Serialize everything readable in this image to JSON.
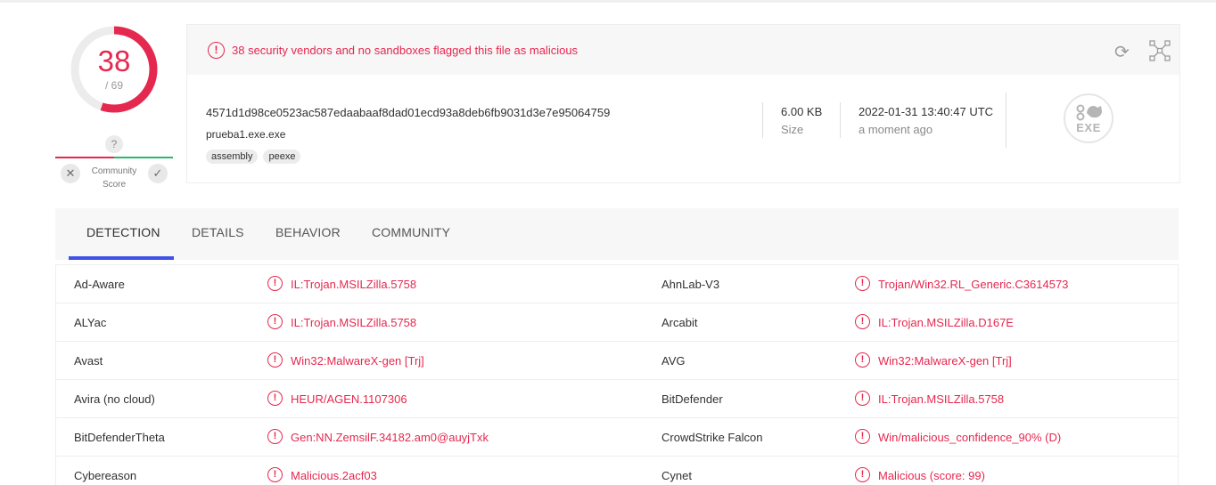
{
  "score": {
    "detections": "38",
    "total": "/ 69",
    "malicious_count": 38,
    "engine_count": 69,
    "ring_color": "#e5284f"
  },
  "community": {
    "unknown_glyph": "?",
    "label_line1": "Community",
    "label_line2": "Score"
  },
  "alert": {
    "text": "38 security vendors and no sandboxes flagged this file as malicious",
    "color": "#e5284f"
  },
  "file": {
    "hash": "4571d1d98ce0523ac587edaabaaf8dad01ecd93a8deb6fb9031d3e7e95064759",
    "name": "prueba1.exe.exe",
    "tags": [
      "assembly",
      "peexe"
    ],
    "size_value": "6.00 KB",
    "size_label": "Size",
    "date_value": "2022-01-31 13:40:47 UTC",
    "date_label": "a moment ago",
    "type_icon": "EXE"
  },
  "tabs": [
    {
      "label": "DETECTION",
      "active": true
    },
    {
      "label": "DETAILS",
      "active": false
    },
    {
      "label": "BEHAVIOR",
      "active": false
    },
    {
      "label": "COMMUNITY",
      "active": false
    }
  ],
  "detections": [
    {
      "left": {
        "engine": "Ad-Aware",
        "result": "IL:Trojan.MSILZilla.5758"
      },
      "right": {
        "engine": "AhnLab-V3",
        "result": "Trojan/Win32.RL_Generic.C3614573"
      }
    },
    {
      "left": {
        "engine": "ALYac",
        "result": "IL:Trojan.MSILZilla.5758"
      },
      "right": {
        "engine": "Arcabit",
        "result": "IL:Trojan.MSILZilla.D167E"
      }
    },
    {
      "left": {
        "engine": "Avast",
        "result": "Win32:MalwareX-gen [Trj]"
      },
      "right": {
        "engine": "AVG",
        "result": "Win32:MalwareX-gen [Trj]"
      }
    },
    {
      "left": {
        "engine": "Avira (no cloud)",
        "result": "HEUR/AGEN.1107306"
      },
      "right": {
        "engine": "BitDefender",
        "result": "IL:Trojan.MSILZilla.5758"
      }
    },
    {
      "left": {
        "engine": "BitDefenderTheta",
        "result": "Gen:NN.ZemsilF.34182.am0@auyjTxk"
      },
      "right": {
        "engine": "CrowdStrike Falcon",
        "result": "Win/malicious_confidence_90% (D)"
      }
    },
    {
      "left": {
        "engine": "Cybereason",
        "result": "Malicious.2acf03"
      },
      "right": {
        "engine": "Cynet",
        "result": "Malicious (score: 99)"
      }
    }
  ],
  "icons": {
    "alert": "alert-circle-icon",
    "reload": "reload-icon",
    "graph": "graph-expand-icon",
    "detection": "alert-circle-icon",
    "vote_down": "close-icon",
    "vote_up": "check-icon"
  }
}
